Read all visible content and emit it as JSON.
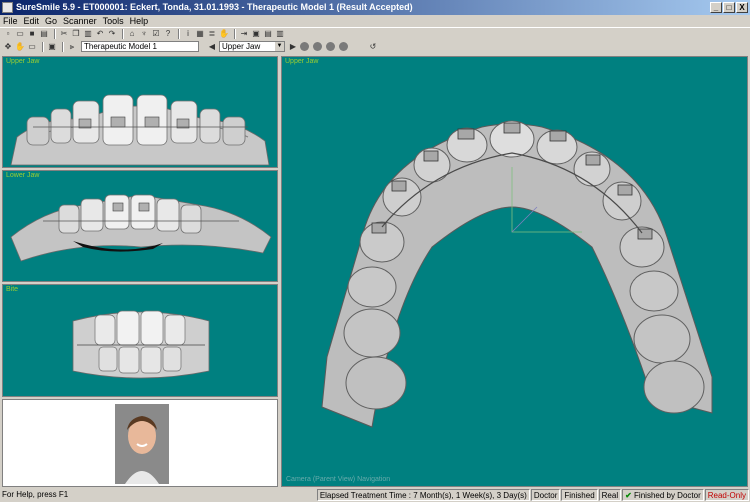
{
  "window": {
    "title": "SureSmile 5.9 - ET000001: Eckert, Tonda, 31.01.1993 - Therapeutic Model 1 (Result Accepted)",
    "controls": [
      "_",
      "□",
      "X"
    ]
  },
  "menu": [
    "File",
    "Edit",
    "Go",
    "Scanner",
    "Tools",
    "Help"
  ],
  "toolbar2": {
    "model_select": "Therapeutic Model 1",
    "jaw_select": "Upper Jaw"
  },
  "panels": {
    "upper_jaw_label": "Upper Jaw",
    "lower_jaw_label": "Lower Jaw",
    "occlusion_label": "Bite",
    "main_label": "Upper Jaw",
    "camera_status": "Camera (Parent View) Navigation"
  },
  "statusbar": {
    "help": "For Help, press F1",
    "elapsed": "Elapsed Treatment Time : 7 Month(s), 1 Week(s), 3 Day(s)",
    "doctor": "Doctor",
    "finished": "Finished",
    "real": "Real",
    "finished_by": "Finished by Doctor",
    "readonly": "Read-Only"
  },
  "colors": {
    "viewport_bg": "#008080",
    "titlebar": "#0a246a",
    "label": "#9acd32",
    "readonly": "#c00000"
  }
}
